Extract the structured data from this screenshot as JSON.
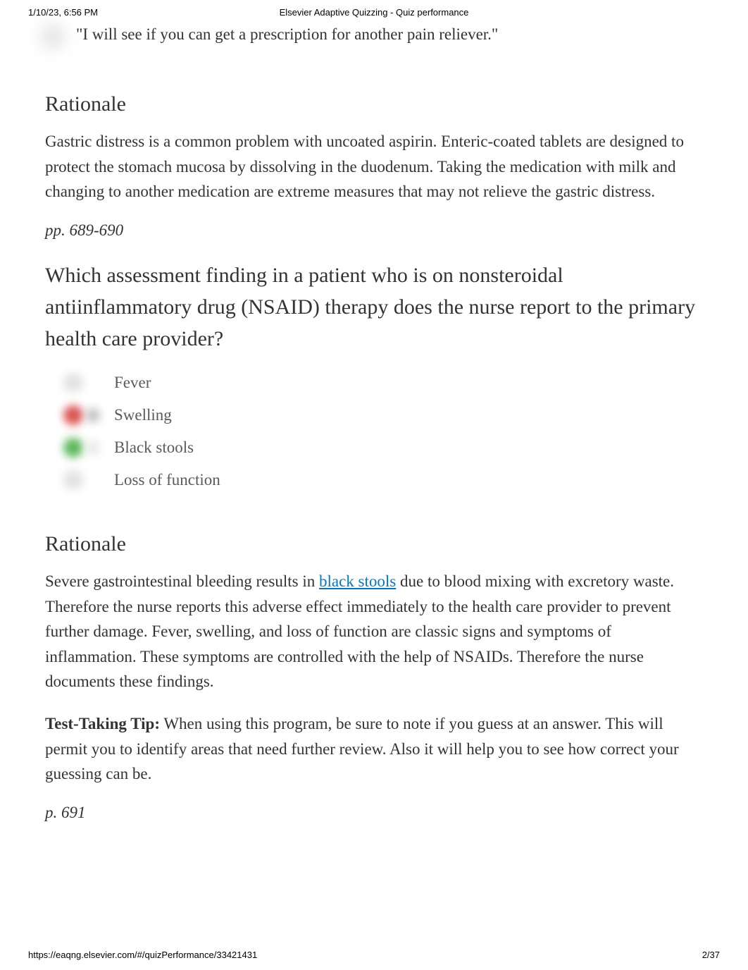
{
  "print": {
    "timestamp": "1/10/23, 6:56 PM",
    "title": "Elsevier Adaptive Quizzing - Quiz performance",
    "url": "https://eaqng.elsevier.com/#/quizPerformance/33421431",
    "page_num": "2/37"
  },
  "q1": {
    "trailing_option": "\"I will see if you can get a prescription for another pain reliever.\"",
    "rationale_heading": "Rationale",
    "rationale_body": "Gastric distress is a common problem with uncoated aspirin. Enteric-coated tablets are designed to protect the stomach mucosa by dissolving in the duodenum. Taking the medication with milk and changing to another medication are extreme measures that may not relieve the gastric distress.",
    "page_ref": "pp. 689-690"
  },
  "q2": {
    "stem": "Which assessment finding in a patient who is on nonsteroidal antiinflammatory drug (NSAID) therapy does the nurse report to the primary health care provider?",
    "options": [
      {
        "label": "Fever"
      },
      {
        "label": "Swelling"
      },
      {
        "label": "Black stools"
      },
      {
        "label": "Loss of function"
      }
    ],
    "rationale_heading": "Rationale",
    "rationale_pre": "Severe gastrointestinal bleeding results in ",
    "rationale_link": "black stools",
    "rationale_post": " due to blood mixing with excretory waste. Therefore the nurse reports this adverse effect immediately to the health care provider to prevent further damage. Fever, swelling, and loss of function are classic signs and symptoms of inflammation. These symptoms are controlled with the help of NSAIDs. Therefore the nurse documents these findings.",
    "tip_label": "Test-Taking Tip:",
    "tip_body": " When using this program, be sure to note if you guess at an answer. This will permit you to identify areas that need further review. Also it will help you to see how correct your guessing can be.",
    "page_ref": "p. 691"
  }
}
